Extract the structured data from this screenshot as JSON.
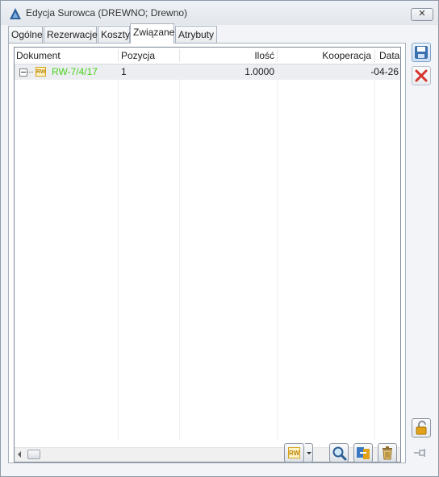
{
  "window": {
    "title": "Edycja Surowca (DREWNO; Drewno)",
    "close_glyph": "✕",
    "icon": "app-logo-icon"
  },
  "tabs": [
    {
      "label": "Ogólne",
      "active": false
    },
    {
      "label": "Rezerwacje",
      "active": false
    },
    {
      "label": "Koszty",
      "active": false
    },
    {
      "label": "Związane",
      "active": true
    },
    {
      "label": "Atrybuty",
      "active": false
    }
  ],
  "grid": {
    "columns": [
      "Dokument",
      "Pozycja",
      "Ilość",
      "Kooperacja",
      "Data"
    ],
    "rows": [
      {
        "expander": "−",
        "type_badge": "RW",
        "dokument": "RW-7/4/17",
        "pozycja": "1",
        "ilosc": "1.0000",
        "kooperacja": "",
        "data": "-04-26"
      }
    ]
  },
  "side_toolbar": {
    "save_icon": "save-disk-icon",
    "cancel_icon": "cancel-x-icon",
    "lock_icon": "padlock-open-icon",
    "pin_icon": "pin-icon"
  },
  "bottom_toolbar": {
    "rw_badge": "RW",
    "icons": [
      "rw-document-icon",
      "dropdown-arrow-icon",
      "magnifier-icon",
      "link-icon",
      "trash-icon"
    ]
  },
  "colors": {
    "link_green": "#49d11d",
    "accent_blue": "#3a6fb0",
    "cancel_red": "#d6332c",
    "row_highlight": "#eceef1"
  }
}
